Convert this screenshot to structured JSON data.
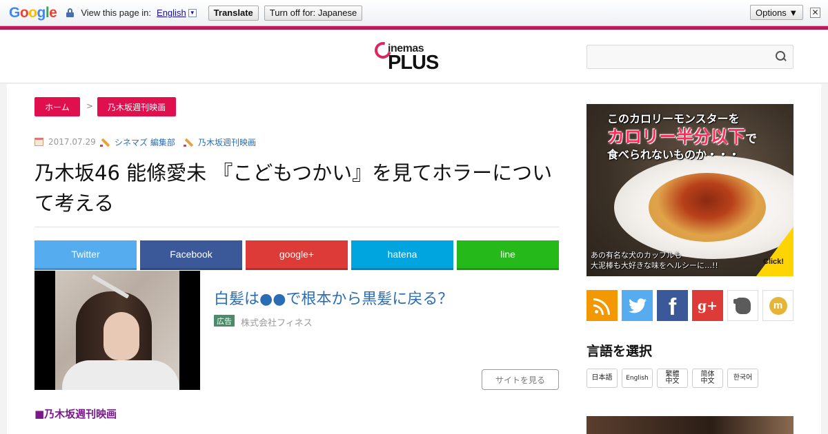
{
  "translate_bar": {
    "logo": "Google",
    "view_text": "View this page in:",
    "language": "English",
    "language_dropdown": "▼",
    "translate_label": "Translate",
    "turn_off_label": "Turn off for: Japanese",
    "options_label": "Options ▼",
    "close_glyph": "✕"
  },
  "header": {
    "logo_top": "inemas",
    "logo_bottom": "PLUS",
    "search_placeholder": ""
  },
  "breadcrumb": {
    "home": "ホーム",
    "separator": ">",
    "category": "乃木坂週刊映画"
  },
  "meta": {
    "date": "2017.07.29",
    "author": "シネマズ 編集部",
    "tag": "乃木坂週刊映画"
  },
  "article": {
    "title": "乃木坂46 能條愛未 『こどもつかい』を見てホラーについて考える",
    "section_heading": "■乃木坂週刊映画"
  },
  "share": [
    {
      "label": "Twitter",
      "color": "#55acee"
    },
    {
      "label": "Facebook",
      "color": "#3b5998"
    },
    {
      "label": "google+",
      "color": "#dd3b37"
    },
    {
      "label": "hatena",
      "color": "#00a4de"
    },
    {
      "label": "line",
      "color": "#25b91a"
    }
  ],
  "ad": {
    "title": "白髪は●●で根本から黒髪に戻る？",
    "badge": "広告",
    "sponsor": "株式会社フィネス",
    "button": "サイトを見る"
  },
  "banner": {
    "line1": "このカロリーモンスターを",
    "line2": "カロリー半分以下",
    "line2_suffix": "で",
    "line3": "食べられないものか・・・",
    "caption1": "あの有名な犬のカップルも",
    "caption2": "大泥棒も大好きな味をヘルシーに…!!",
    "click": "Click!"
  },
  "social": {
    "rss_color": "#f39800",
    "twitter_color": "#55acee",
    "facebook_color": "#3b5998",
    "googleplus_color": "#dd3b37",
    "googleplus_label": "g+",
    "facebook_label": "f",
    "twitter_glyph": "🐦",
    "mixi_label": "m"
  },
  "language_select": {
    "heading": "言語を選択",
    "options": [
      "日本語",
      "English",
      "繁體中文",
      "简体中文",
      "한국어"
    ]
  }
}
